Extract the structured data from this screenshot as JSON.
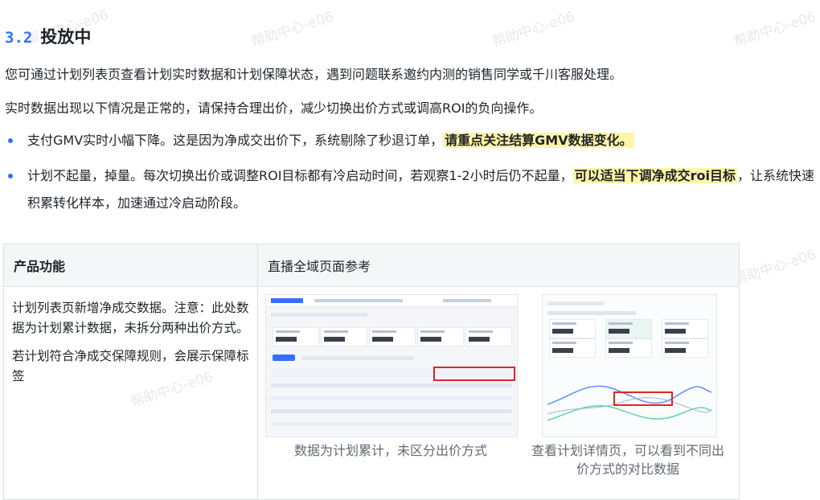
{
  "watermark": "帮助中心-e06",
  "section": {
    "number": "3.2",
    "title": "投放中"
  },
  "intro": "您可通过计划列表页查看计划实时数据和计划保障状态，遇到问题联系邀约内测的销售同学或千川客服处理。",
  "normal_note": "实时数据出现以下情况是正常的，请保持合理出价，减少切换出价方式或调高ROI的负向操作。",
  "bullets": [
    {
      "text": "支付GMV实时小幅下降。这是因为净成交出价下，系统剔除了秒退订单，",
      "highlight": "请重点关注结算GMV数据变化。",
      "tail": ""
    },
    {
      "text": "计划不起量，掉量。每次切换出价或调整ROI目标都有冷启动时间，若观察1-2小时后仍不起量，",
      "highlight": "可以适当下调净成交roi目标",
      "tail": "，让系统快速积累转化样本，加速通过冷启动阶段。"
    }
  ],
  "table": {
    "headers": [
      "产品功能",
      "直播全域页面参考"
    ],
    "rows": [
      {
        "feature_p1": "计划列表页新增净成交数据。注意：此处数据为计划累计数据，未拆分两种出价方式。",
        "feature_p2": "若计划符合净成交保障规则，会展示保障标签",
        "captions": [
          "数据为计划累计，未区分出价方式",
          "查看计划详情页，可以看到不同出价方式的对比数据"
        ]
      }
    ]
  },
  "colors": {
    "accent": "#3370ff",
    "highlight": "#fff5a8",
    "annotation_box": "#e02424"
  }
}
